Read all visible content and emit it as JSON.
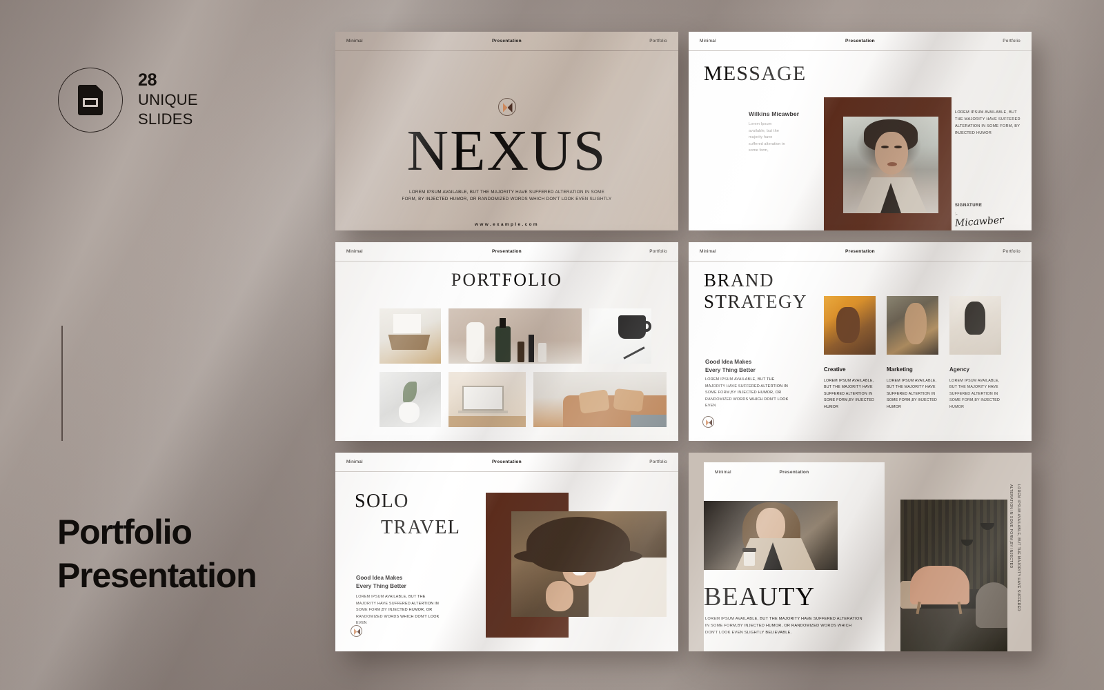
{
  "promo": {
    "badge_count": "28",
    "badge_line1": "UNIQUE",
    "badge_line2": "SLIDES",
    "title_line1": "Portfolio",
    "title_line2": "Presentation"
  },
  "slide_header": {
    "left": "Minimal",
    "center": "Presentation",
    "right": "Portfolio"
  },
  "slides": {
    "cover": {
      "title": "NEXUS",
      "lede": "LOREM IPSUM AVAILABLE, BUT THE MAJORITY HAVE SUFFERED ALTERATION IN SOME FORM, BY INJECTED HUMOR, OR RANDOMIZED WORDS WHICH DON'T LOOK EVEN SLIGHTLY",
      "website": "www.example.com"
    },
    "message": {
      "title": "MESSAGE",
      "person_name": "Wilkins Micawber",
      "person_body": "Lorem Ipsum available, but the majority have suffered alteration in some form,",
      "right_body": "LOREM IPSUM AVAILABLE, BUT THE MAJORITY HAVE SUFFERED ALTERATION IN SOME FORM, BY INJECTED HUMOR",
      "signature_label": "SIGNATURE",
      "signature_dash": ":-",
      "signature_name": "Micawber"
    },
    "portfolio": {
      "title": "PORTFOLIO"
    },
    "brand_strategy": {
      "title_line1": "BRAND",
      "title_line2": "STRATEGY",
      "subtitle_line1": "Good Idea Makes",
      "subtitle_line2": "Every Thing Better",
      "body": "LOREM IPSUM AVAILABLE, BUT THE MAJORITY HAVE SUFFERED ALTERTION IN SOME FORM,BY INJECTED HUMOR, OR RANDOMIZED WORDS WHICH DON'T LOOK EVEN",
      "cards": [
        {
          "name": "Creative",
          "body": "LOREM IPSUM AVAILABLE, BUT THE MAJORITY HAVE SUFFERED ALTERTION IN SOME FORM,BY INJECTED HUMOR"
        },
        {
          "name": "Marketing",
          "body": "LOREM IPSUM AVAILABLE, BUT THE MAJORITY HAVE SUFFERED ALTERTION IN SOME FORM,BY INJECTED HUMOR"
        },
        {
          "name": "Agency",
          "body": "LOREM IPSUM AVAILABLE, BUT THE MAJORITY HAVE SUFFERED ALTERTION IN SOME FORM,BY INJECTED HUMOR"
        }
      ]
    },
    "solo_travel": {
      "title_line1": "SOLO",
      "title_line2": "TRAVEL",
      "subtitle_line1": "Good Idea Makes",
      "subtitle_line2": "Every Thing Better",
      "body": "LOREM IPSUM AVAILABLE, BUT THE MAJORITY HAVE SUFFERED ALTERTION IN SOME FORM,BY INJECTED HUMOR, OR RANDOMIZED WORDS WHICH DON'T LOOK EVEN"
    },
    "beauty": {
      "title": "BEAUTY",
      "body": "LOREM IPSUM AVAILABLE, BUT THE MAJORITY HAVE SUFFERED ALTERATION IN SOME FORM,BY INJECTED HUMOR, OR RANDOMIZED WORDS WHICH DON'T LOOK EVEN SLIGHTLY BELIEVABLE.",
      "vertical_line1": "LOREM IPSUM AVAILABLE, BUT THE MAJORITY HAVE SUFFERED",
      "vertical_line2": "ALTERATION IN SOME FORM,BY INJECTED"
    }
  },
  "colors": {
    "accent_brown": "#5b2c1c",
    "accent_orange": "#d08a5d",
    "background": "#a2968f",
    "text_dark": "#0b0908"
  }
}
